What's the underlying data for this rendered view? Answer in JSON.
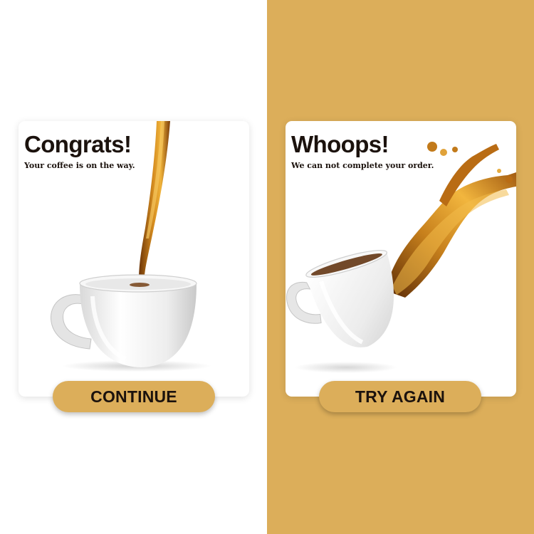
{
  "success_card": {
    "title": "Congrats!",
    "subtitle": "Your coffee is on the way.",
    "button_label": "CONTINUE"
  },
  "error_card": {
    "title": "Whoops!",
    "subtitle": "We can not complete your order.",
    "button_label": "TRY AGAIN"
  },
  "colors": {
    "accent": "#dcae5a",
    "text": "#1b120d",
    "card": "#ffffff",
    "coffee": "#8a4a10"
  },
  "icons": [
    "coffee-pour-illustration",
    "coffee-spill-illustration"
  ]
}
